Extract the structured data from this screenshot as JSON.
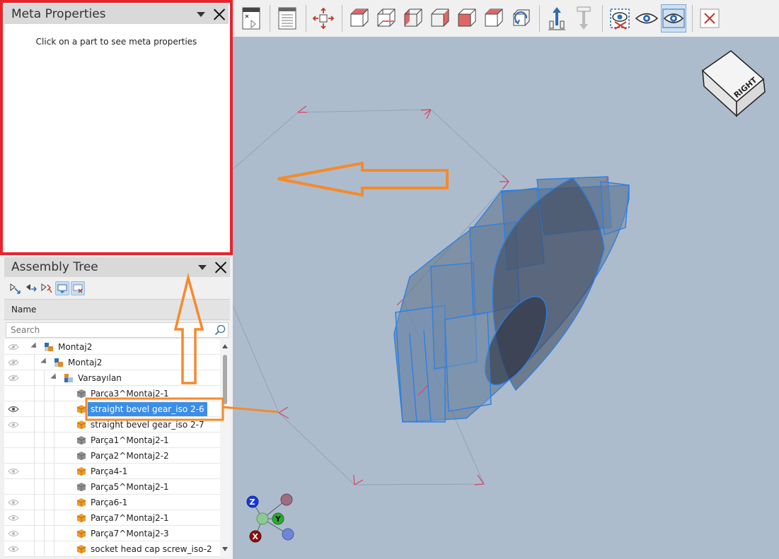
{
  "meta_panel": {
    "title": "Meta Properties",
    "hint": "Click on a part to see meta properties"
  },
  "tree_panel": {
    "title": "Assembly Tree",
    "column_name": "Name",
    "search_placeholder": "Search",
    "rows": [
      {
        "label": "Montaj2",
        "level": 0,
        "icon": "assembly-icon",
        "visible_icon": "hidden-eye-icon"
      },
      {
        "label": "Montaj2",
        "level": 1,
        "icon": "assembly-icon",
        "visible_icon": "hidden-eye-icon"
      },
      {
        "label": "Varsayılan",
        "level": 2,
        "icon": "config-icon",
        "visible_icon": "hidden-eye-icon"
      },
      {
        "label": "Parça3^Montaj2-1",
        "level": 3,
        "icon": "part-gray-icon",
        "visible_icon": ""
      },
      {
        "label": "straight bevel gear_iso 2-6",
        "level": 3,
        "icon": "part-orange-icon",
        "visible_icon": "eye-icon",
        "selected": true
      },
      {
        "label": "straight bevel gear_iso 2-7",
        "level": 3,
        "icon": "part-orange-icon",
        "visible_icon": "faint-eye-icon"
      },
      {
        "label": "Parça1^Montaj2-1",
        "level": 3,
        "icon": "part-gray-icon",
        "visible_icon": ""
      },
      {
        "label": "Parça2^Montaj2-2",
        "level": 3,
        "icon": "part-gray-icon",
        "visible_icon": ""
      },
      {
        "label": "Parça4-1",
        "level": 3,
        "icon": "part-orange-icon",
        "visible_icon": "faint-eye-icon"
      },
      {
        "label": "Parça5^Montaj2-1",
        "level": 3,
        "icon": "part-gray-icon",
        "visible_icon": ""
      },
      {
        "label": "Parça6-1",
        "level": 3,
        "icon": "part-orange-icon",
        "visible_icon": "faint-eye-icon"
      },
      {
        "label": "Parça7^Montaj2-1",
        "level": 3,
        "icon": "part-orange-icon",
        "visible_icon": "faint-eye-icon"
      },
      {
        "label": "Parça7^Montaj2-3",
        "level": 3,
        "icon": "part-orange-icon",
        "visible_icon": "faint-eye-icon"
      },
      {
        "label": "socket head cap screw_iso-2",
        "level": 3,
        "icon": "part-orange-icon",
        "visible_icon": "faint-eye-icon"
      }
    ]
  },
  "toolbar": {
    "tools": [
      "view-settings-icon",
      "document-icon",
      "fit-all-icon",
      "view-front-icon",
      "view-back-icon",
      "view-left-icon",
      "view-right-icon",
      "view-top-icon",
      "view-bottom-icon",
      "rotate-view-icon",
      "explode-up-icon",
      "explode-down-icon",
      "hide-selected-icon",
      "show-all-icon",
      "show-selected-icon",
      "close-icon"
    ]
  },
  "viewcube": {
    "label": "RIGHT"
  },
  "axis_triad": {
    "z": "Z",
    "y": "Y",
    "x": "X"
  },
  "colors": {
    "accent_red": "#e8232b",
    "annotation_orange": "#f58a2b",
    "selection_blue": "#3b8ee7",
    "viewport_bg": "#acbccd"
  }
}
